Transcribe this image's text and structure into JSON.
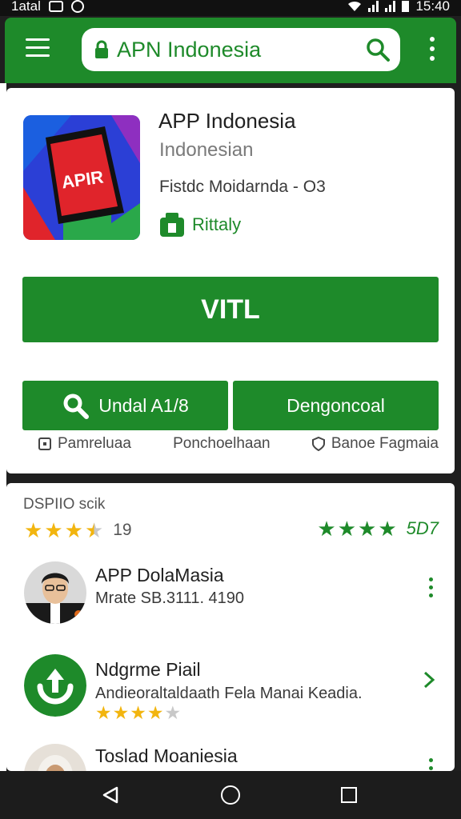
{
  "status_bar": {
    "carrier": "1atal",
    "time": "15:40"
  },
  "app_bar": {
    "search_query": "APN Indonesia"
  },
  "app": {
    "title": "APP Indonesia",
    "subtitle": "Indonesian",
    "meta": "Fistdc Moidarnda - O3",
    "rating_label": "Rittaly",
    "icon_text": "APIR",
    "install_label": "VITL"
  },
  "actions": {
    "primary_label": "Undal A1/8",
    "secondary_label": "Dengoncoal"
  },
  "links": {
    "first": "Pamreluaa",
    "second": "Ponchoelhaan",
    "third": "Banoe Fagmaia"
  },
  "reviews": {
    "section_title": "DSPIIO scik",
    "left_rating": 3.5,
    "left_count": "19",
    "right_rating": 4,
    "right_count": "5D7"
  },
  "list": [
    {
      "title": "APP DolaMasia",
      "subtitle": "Mrate SB.3111. 4190"
    },
    {
      "title": "Ndgrme Piail",
      "subtitle": "Andieoraltaldaath Fela Manai Keadia.",
      "rating": 4
    },
    {
      "title": "Toslad Moaniesia"
    }
  ],
  "colors": {
    "primary": "#1e8a2a",
    "star": "#f2b50f"
  }
}
